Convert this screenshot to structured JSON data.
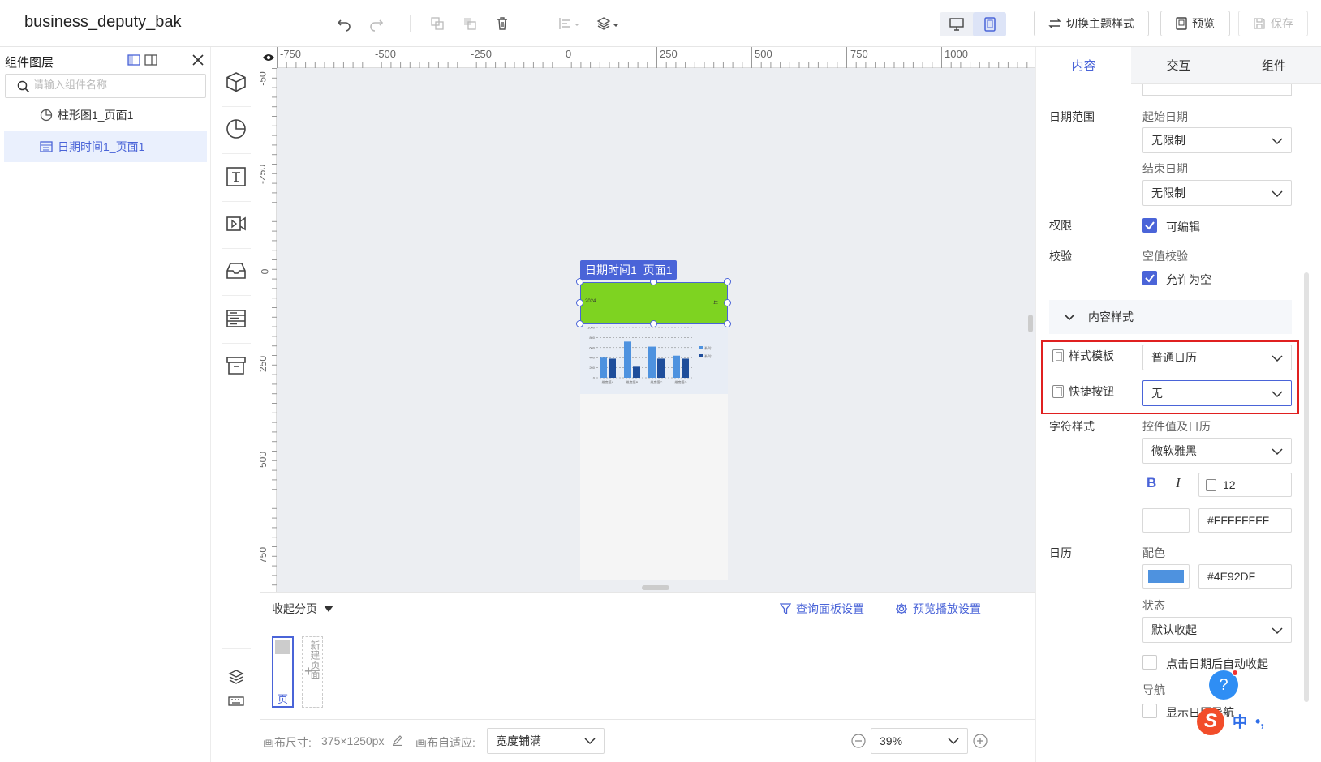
{
  "app": {
    "title": "business_deputy_bak"
  },
  "toolbar": {
    "undo": "undo-icon",
    "redo": "redo-icon",
    "switch_theme_label": "切换主题样式",
    "preview_label": "预览",
    "save_label": "保存"
  },
  "layers": {
    "title": "组件图层",
    "search_placeholder": "请输入组件名称",
    "items": [
      {
        "label": "柱形图1_页面1",
        "icon": "pie-chart-icon"
      },
      {
        "label": "日期时间1_页面1",
        "icon": "calendar-widget-icon"
      }
    ]
  },
  "canvas": {
    "ruler_h_labels": [
      "-750",
      "-500",
      "-250",
      "0",
      "250",
      "500",
      "750",
      "1000"
    ],
    "ruler_v_labels": [
      "-50",
      "-250",
      "0",
      "250",
      "500",
      "750"
    ],
    "selected_widget_label": "日期时间1_页面1",
    "widget_year": "2024",
    "widget_suffix": "年",
    "widget_color": "#7ED321",
    "accent": "#4A64D8"
  },
  "pages": {
    "collapse_label": "收起分页",
    "query_panel_label": "查询面板设置",
    "preview_play_label": "预览播放设置",
    "page_thumb_label": "页",
    "new_page_text": "新建页面"
  },
  "status": {
    "canvas_size_label": "画布尺寸:",
    "canvas_size_value": "375×1250px",
    "auto_fit_label": "画布自适应:",
    "auto_fit_value": "宽度铺满",
    "zoom_value": "39%"
  },
  "props": {
    "tabs": [
      "内容",
      "交互",
      "组件"
    ],
    "date_range_label": "日期范围",
    "start_date_label": "起始日期",
    "start_date_value": "无限制",
    "end_date_label": "结束日期",
    "end_date_value": "无限制",
    "permission_label": "权限",
    "editable_label": "可编辑",
    "validation_label": "校验",
    "null_check_label": "空值校验",
    "allow_null_label": "允许为空",
    "content_style_header": "内容样式",
    "style_template_label": "样式模板",
    "style_template_value": "普通日历",
    "shortcut_label": "快捷按钮",
    "shortcut_value": "无",
    "font_style_label": "字符样式",
    "control_value_label": "控件值及日历",
    "font_value": "微软雅黑",
    "bold_label": "B",
    "italic_label": "I",
    "font_size_value": "12",
    "font_color_value": "#FFFFFFFF",
    "calendar_label": "日历",
    "color_scheme_label": "配色",
    "calendar_color_value": "#4E92DF",
    "state_label": "状态",
    "state_value": "默认收起",
    "auto_collapse_label": "点击日期后自动收起",
    "nav_label": "导航",
    "show_nav_label": "显示日历导航"
  },
  "chart_data": {
    "type": "bar",
    "categories": [
      "维度值A",
      "维度值B",
      "维度值C",
      "维度值D"
    ],
    "series": [
      {
        "name": "系列1",
        "values": [
          400,
          720,
          620,
          440
        ],
        "color": "#4E92DF"
      },
      {
        "name": "系列2",
        "values": [
          380,
          220,
          380,
          380
        ],
        "color": "#1F4E9B"
      }
    ],
    "ylim": [
      0,
      1000
    ],
    "yticks": [
      "0",
      "200",
      "400",
      "600",
      "800",
      "1000"
    ]
  }
}
